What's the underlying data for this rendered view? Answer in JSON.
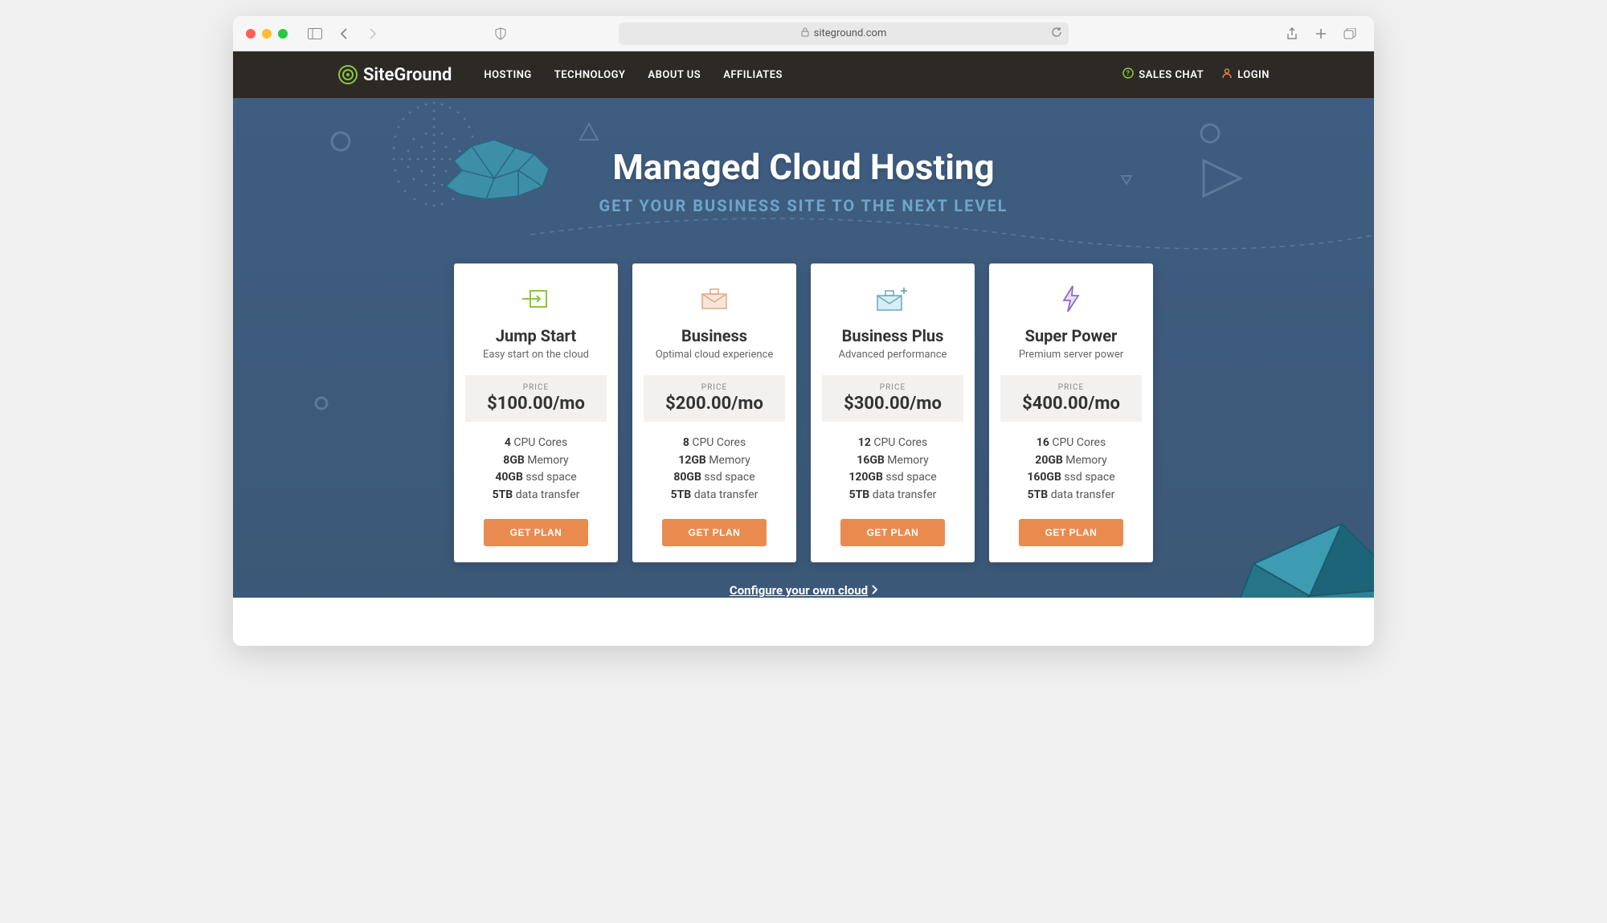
{
  "browser": {
    "url": "siteground.com"
  },
  "header": {
    "brand": "SiteGround",
    "nav": [
      "HOSTING",
      "TECHNOLOGY",
      "ABOUT US",
      "AFFILIATES"
    ],
    "sales_chat": "SALES CHAT",
    "login": "LOGIN"
  },
  "hero": {
    "title": "Managed Cloud Hosting",
    "subtitle": "GET YOUR BUSINESS SITE TO THE NEXT LEVEL",
    "configure_link": "Configure your own cloud"
  },
  "plans": [
    {
      "name": "Jump Start",
      "tagline": "Easy start on the cloud",
      "price_label": "PRICE",
      "price": "$100.00/mo",
      "specs": [
        {
          "bold": "4",
          "text": " CPU Cores"
        },
        {
          "bold": "8GB",
          "text": " Memory"
        },
        {
          "bold": "40GB",
          "text": " ssd space"
        },
        {
          "bold": "5TB",
          "text": " data transfer"
        }
      ],
      "cta": "GET PLAN"
    },
    {
      "name": "Business",
      "tagline": "Optimal cloud experience",
      "price_label": "PRICE",
      "price": "$200.00/mo",
      "specs": [
        {
          "bold": "8",
          "text": " CPU Cores"
        },
        {
          "bold": "12GB",
          "text": " Memory"
        },
        {
          "bold": "80GB",
          "text": " ssd space"
        },
        {
          "bold": "5TB",
          "text": " data transfer"
        }
      ],
      "cta": "GET PLAN"
    },
    {
      "name": "Business Plus",
      "tagline": "Advanced performance",
      "price_label": "PRICE",
      "price": "$300.00/mo",
      "specs": [
        {
          "bold": "12",
          "text": " CPU Cores"
        },
        {
          "bold": "16GB",
          "text": " Memory"
        },
        {
          "bold": "120GB",
          "text": " ssd space"
        },
        {
          "bold": "5TB",
          "text": " data transfer"
        }
      ],
      "cta": "GET PLAN"
    },
    {
      "name": "Super Power",
      "tagline": "Premium server power",
      "price_label": "PRICE",
      "price": "$400.00/mo",
      "specs": [
        {
          "bold": "16",
          "text": " CPU Cores"
        },
        {
          "bold": "20GB",
          "text": " Memory"
        },
        {
          "bold": "160GB",
          "text": " ssd space"
        },
        {
          "bold": "5TB",
          "text": " data transfer"
        }
      ],
      "cta": "GET PLAN"
    }
  ]
}
